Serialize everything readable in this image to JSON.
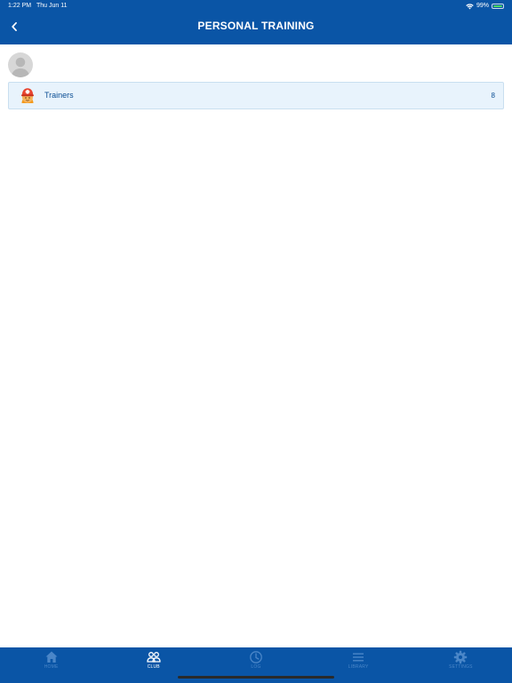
{
  "status_bar": {
    "time": "1:22 PM",
    "date": "Thu Jun 11",
    "battery_percent": "99%",
    "battery_level": 0.99
  },
  "nav": {
    "title": "PERSONAL TRAINING",
    "back_icon": "chevron-left-icon"
  },
  "list": {
    "items": [
      {
        "label": "Trainers",
        "count": "8",
        "icon": "trainer-icon"
      }
    ]
  },
  "tab_bar": {
    "tabs": [
      {
        "label": "HOME",
        "icon": "home-icon",
        "active": false
      },
      {
        "label": "CLUB",
        "icon": "club-icon",
        "active": true
      },
      {
        "label": "LOG",
        "icon": "clock-icon",
        "active": false
      },
      {
        "label": "LIBRARY",
        "icon": "menu-icon",
        "active": false
      },
      {
        "label": "SETTINGS",
        "icon": "gear-icon",
        "active": false
      }
    ]
  },
  "colors": {
    "header_blue": "#0a55a6",
    "list_bg": "#e8f3fc",
    "list_text": "#0a4d93",
    "tab_inactive": "#4a86c8",
    "tab_active": "#ffffff"
  }
}
